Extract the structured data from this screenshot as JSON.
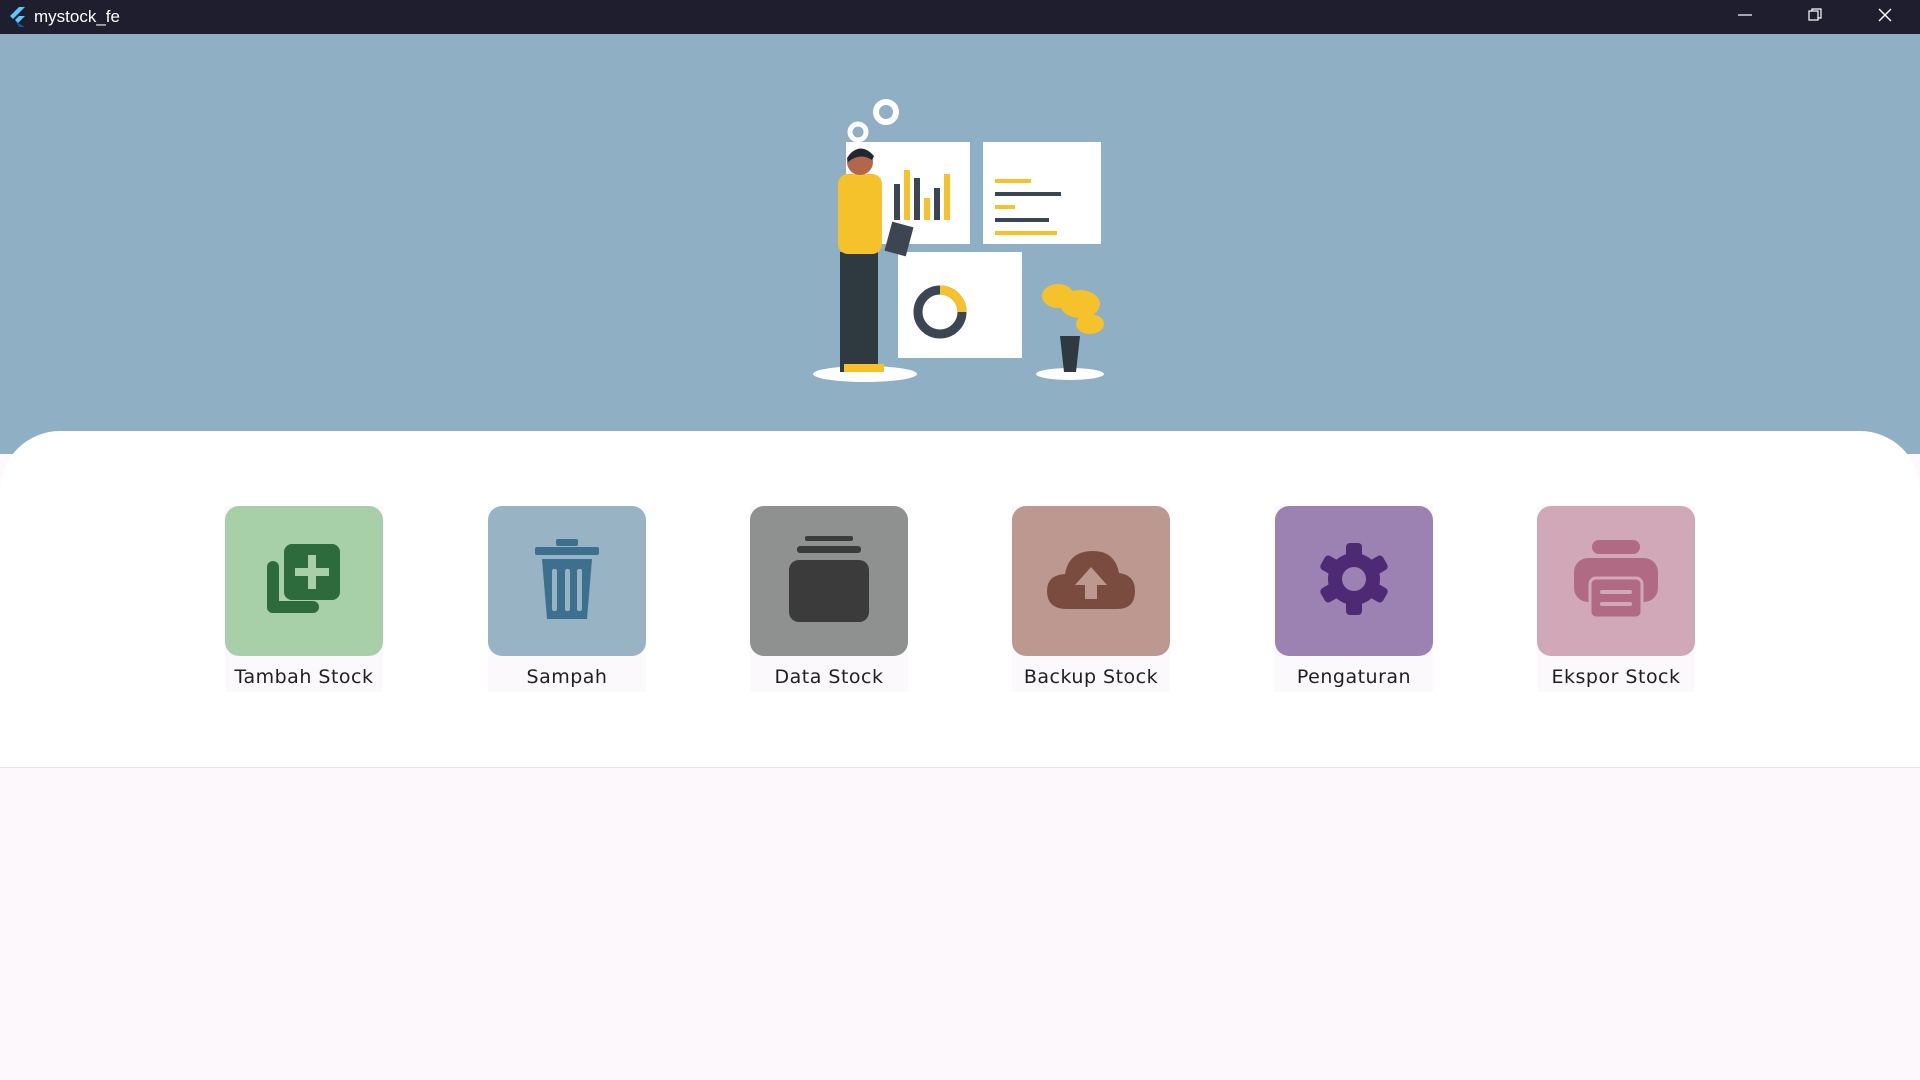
{
  "window": {
    "title": "mystock_fe",
    "controls": [
      "minimize-icon",
      "restore-icon",
      "close-icon"
    ]
  },
  "menu": {
    "items": [
      {
        "label": "Tambah Stock",
        "icon": "add-stock-icon",
        "tile_color": "#a8d0a8",
        "icon_color": "#2e6b3c"
      },
      {
        "label": "Sampah",
        "icon": "trash-icon",
        "tile_color": "#98b3c4",
        "icon_color": "#3d6f8e"
      },
      {
        "label": "Data Stock",
        "icon": "folder-stack-icon",
        "tile_color": "#8f9191",
        "icon_color": "#3b3b3b"
      },
      {
        "label": "Backup Stock",
        "icon": "cloud-upload-icon",
        "tile_color": "#bc9891",
        "icon_color": "#7a4b3f"
      },
      {
        "label": "Pengaturan",
        "icon": "gear-icon",
        "tile_color": "#9b82b2",
        "icon_color": "#4d2a73"
      },
      {
        "label": "Ekspor Stock",
        "icon": "printer-icon",
        "tile_color": "#d0a8b8",
        "icon_color": "#b06a83"
      }
    ]
  },
  "colors": {
    "titlebar": "#1e1e2e",
    "hero_background": "#8fafc5",
    "page_background": "#fdf8fc"
  }
}
